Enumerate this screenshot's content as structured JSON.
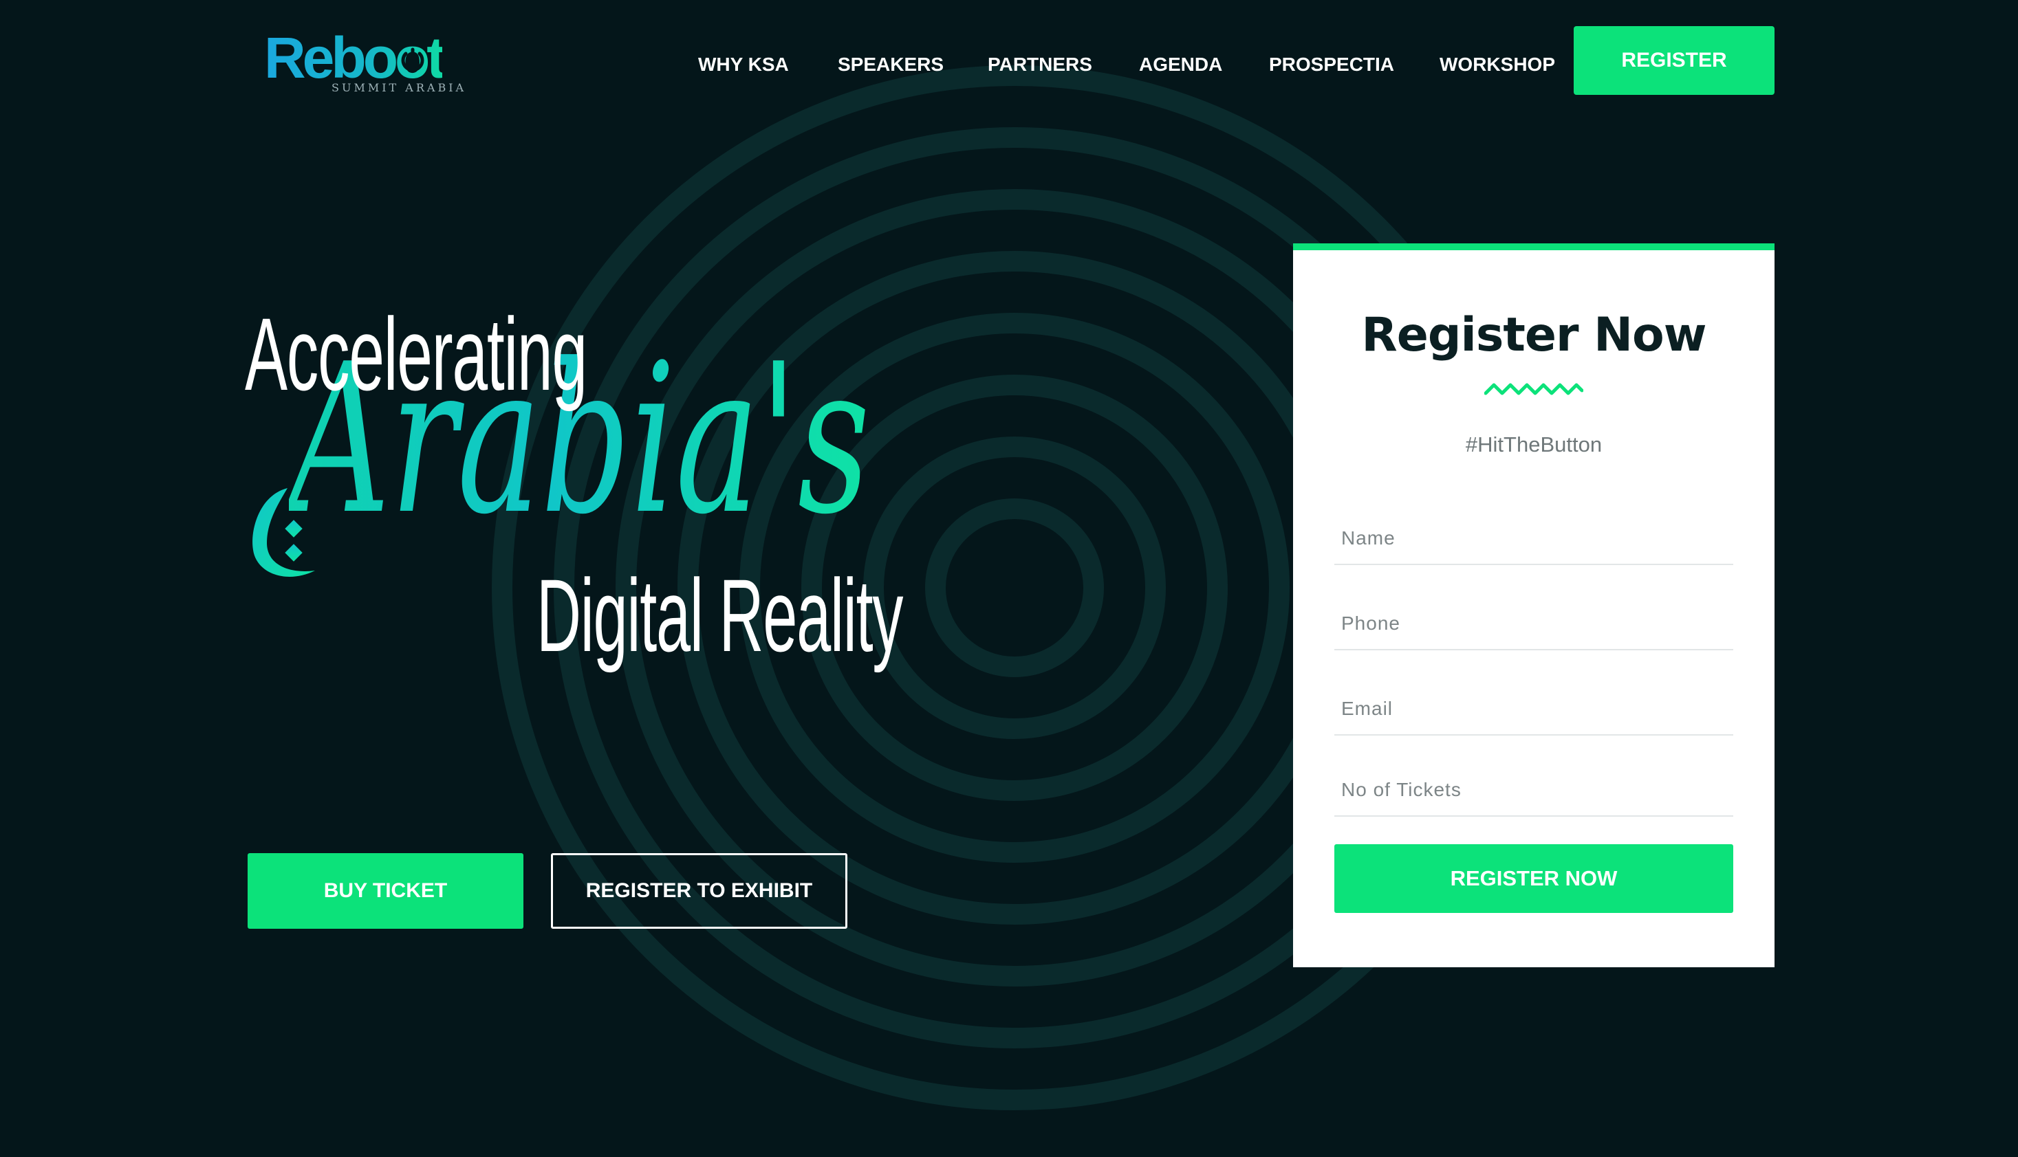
{
  "header": {
    "logo_text": "Reboot",
    "logo_subtitle": "SUMMIT ARABIA",
    "nav": [
      {
        "label": "WHY KSA"
      },
      {
        "label": "SPEAKERS"
      },
      {
        "label": "PARTNERS"
      },
      {
        "label": "AGENDA"
      },
      {
        "label": "PROSPECTIA"
      },
      {
        "label": "WORKSHOP"
      }
    ],
    "register_label": "REGISTER"
  },
  "hero": {
    "line1": "Accelerating",
    "line2": "Arabia's",
    "line3": "Digital Reality",
    "buy_ticket_label": "BUY TICKET",
    "register_exhibit_label": "REGISTER TO EXHIBIT"
  },
  "register_card": {
    "title": "Register Now",
    "hashtag": "#HitTheButton",
    "fields": {
      "name_placeholder": "Name",
      "phone_placeholder": "Phone",
      "email_placeholder": "Email",
      "tickets_placeholder": "No of Tickets"
    },
    "submit_label": "REGISTER NOW"
  },
  "colors": {
    "background": "#04161a",
    "accent_green": "#0ce27a",
    "logo_blue": "#1aa8df",
    "script_teal": "#10c6c8",
    "card_title": "#0b1f22"
  },
  "icons": {
    "logo_power": "power-icon",
    "wave": "wave-divider-icon",
    "ornament": "arabic-ornament-icon"
  }
}
